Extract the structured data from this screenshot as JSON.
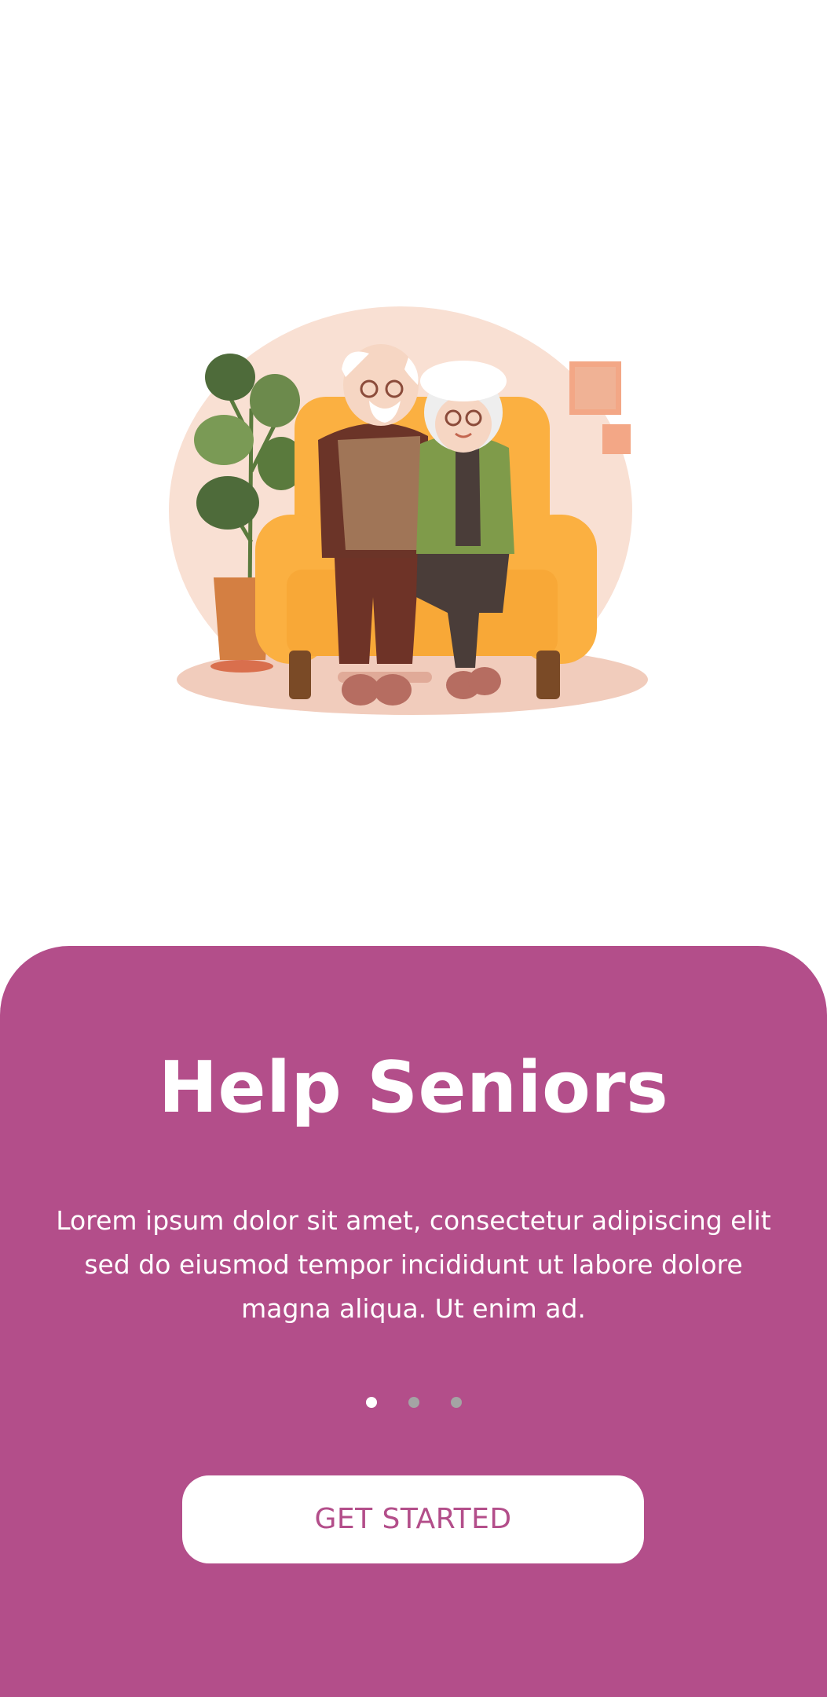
{
  "onboarding": {
    "title": "Help Seniors",
    "description": "Lorem ipsum dolor sit amet, consectetur adipiscing elit sed do eiusmod tempor incididunt ut labore dolore magna aliqua. Ut enim ad.",
    "cta_label": "GET STARTED",
    "pager": {
      "total_pages": 3,
      "active_index": 0
    }
  },
  "illustration": {
    "name": "senior-couple-on-sofa-illustration",
    "icon": "senior-couple-icon"
  },
  "colors": {
    "accent": "#b34e8a",
    "panel_text": "#ffffff",
    "button_background": "#ffffff",
    "dot_active": "#ffffff",
    "dot_inactive": "#a4a4a4"
  }
}
